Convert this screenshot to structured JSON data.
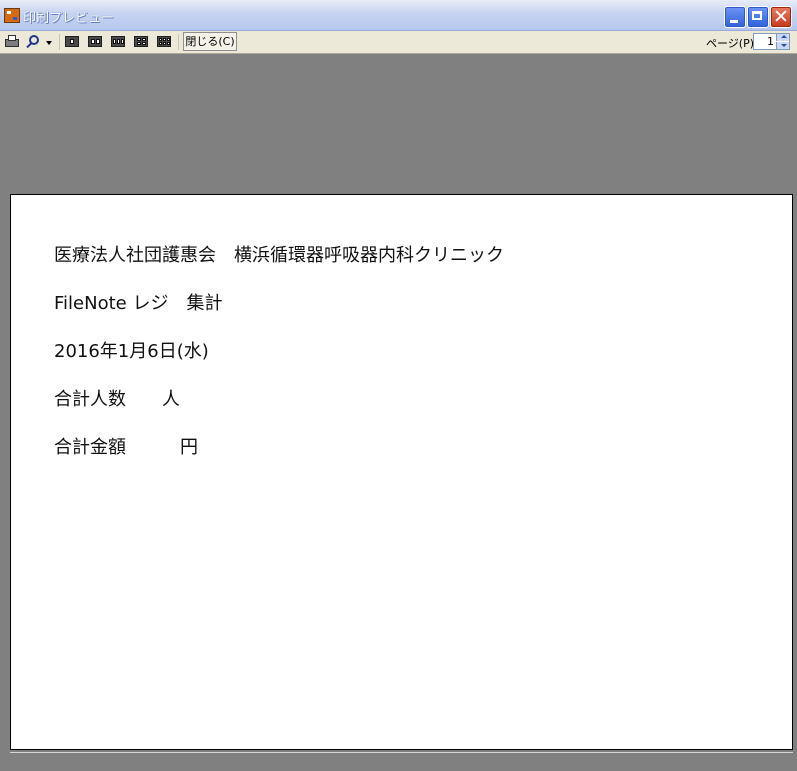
{
  "window": {
    "title": "印刷プレビュー"
  },
  "toolbar": {
    "close_label": "閉じる(C)",
    "page_label": "ページ(P)",
    "page_value": "1"
  },
  "document": {
    "lines": [
      "医療法人社団護惠会　横浜循環器呼吸器内科クリニック",
      "FileNote レジ　集計",
      "2016年1月6日(水)",
      "合計人数　　人",
      "合計金額　　　円"
    ]
  },
  "icons": [
    "print-icon",
    "zoom-icon",
    "one-page-icon",
    "two-pages-icon",
    "three-pages-icon",
    "four-pages-icon",
    "six-pages-icon"
  ]
}
